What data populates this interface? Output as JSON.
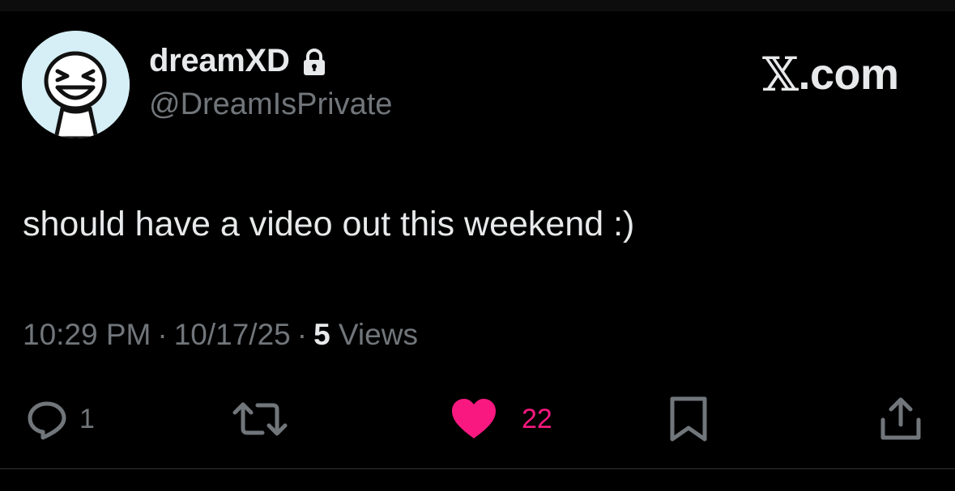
{
  "post": {
    "author": {
      "display_name": "dreamXD",
      "handle": "@DreamIsPrivate",
      "protected_icon": "lock-icon",
      "avatar_color": "#d6eef6"
    },
    "brand": {
      "icon": "x-logo-icon",
      "label": ".com"
    },
    "text": "should have a video out this weekend :)",
    "meta": {
      "time": "10:29 PM",
      "separator": "·",
      "date": "10/17/25",
      "views_count": "5",
      "views_label": "Views"
    },
    "actions": {
      "reply": {
        "icon": "reply-icon",
        "count": "1"
      },
      "retweet": {
        "icon": "retweet-icon",
        "count": ""
      },
      "like": {
        "icon": "heart-icon",
        "count": "22",
        "active": true
      },
      "bookmark": {
        "icon": "bookmark-icon"
      },
      "share": {
        "icon": "share-icon"
      }
    }
  },
  "colors": {
    "background": "#000000",
    "text_primary": "#e7e9ea",
    "text_secondary": "#71767b",
    "like_accent": "#f91880",
    "divider": "#2f3336"
  }
}
